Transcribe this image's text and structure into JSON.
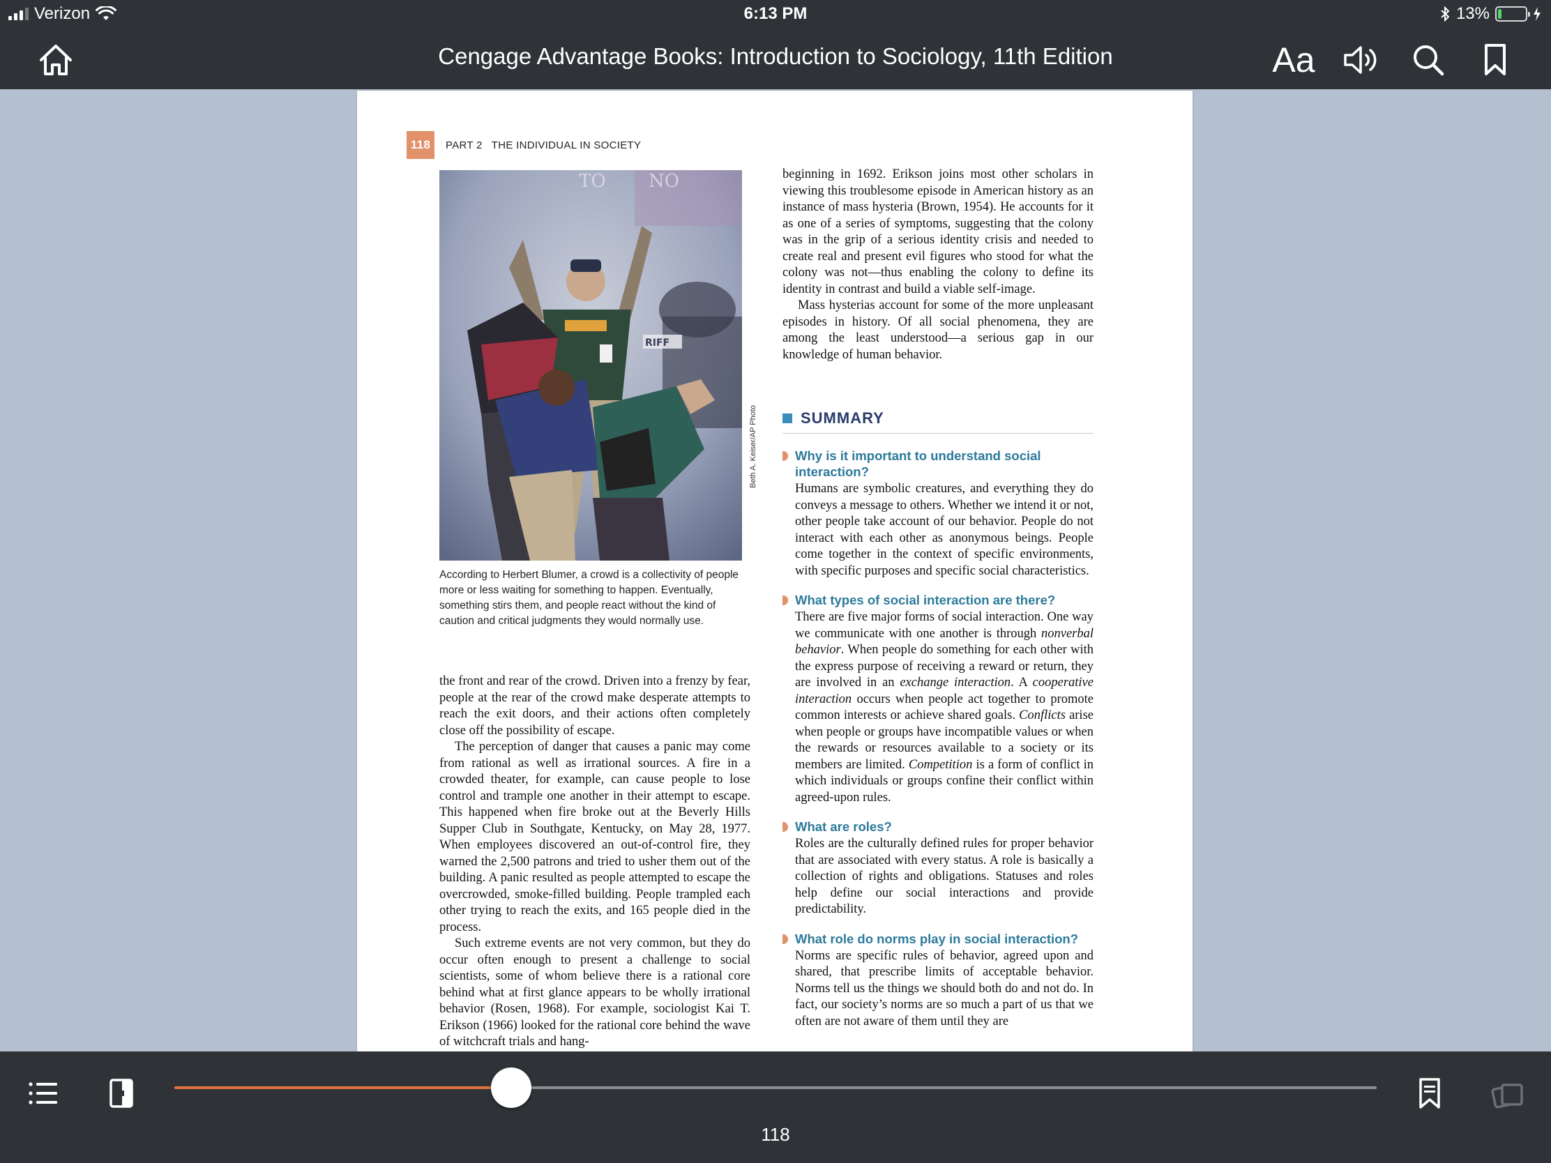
{
  "status_bar": {
    "carrier": "Verizon",
    "time": "6:13 PM",
    "battery_percent": "13%",
    "battery_level": 0.13
  },
  "toolbar": {
    "title": "Cengage Advantage Books: Introduction to Sociology, 11th Edition",
    "font_button": "Aa"
  },
  "page": {
    "number": "118",
    "running_head": "PART 2   THE INDIVIDUAL IN SOCIETY",
    "photo_credit": "Beth A. Keiser/AP Photo",
    "photo_sign_text_left": "TO",
    "photo_sign_text_right": "NO",
    "photo_badge_text": "RIFF",
    "caption": "According to Herbert Blumer, a crowd is a collectivity of people more or less waiting for something to happen. Eventually, something stirs them, and people react without the kind of caution and critical judgments they would normally use.",
    "left_column": [
      "the front and rear of the crowd. Driven into a frenzy by fear, people at the rear of the crowd make desperate attempts to reach the exit doors, and their actions often completely close off the possibility of escape.",
      "The perception of danger that causes a panic may come from rational as well as irrational sources. A fire in a crowded theater, for example, can cause people to lose control and trample one another in their attempt to escape. This happened when fire broke out at the Beverly Hills Supper Club in Southgate, Kentucky, on May 28, 1977. When employees discovered an out-of-control fire, they warned the 2,500 patrons and tried to usher them out of the building. A panic resulted as people attempted to escape the overcrowded, smoke-filled building. People trampled each other trying to reach the exits, and 165 people died in the process.",
      "Such extreme events are not very common, but they do occur often enough to present a challenge to social scientists, some of whom believe there is a rational core behind what at first glance appears to be wholly irrational behavior (Rosen, 1968). For example, sociologist Kai T. Erikson (1966) looked for the rational core behind the wave of witchcraft trials and hang-"
    ],
    "right_column": [
      "beginning in 1692. Erikson joins most other scholars in viewing this troublesome episode in American history as an instance of mass hysteria (Brown, 1954). He accounts for it as one of a series of symptoms, suggesting that the colony was in the grip of a serious identity crisis and needed to create real and present evil figures who stood for what the colony was not—thus enabling the colony to define its identity in contrast and build a viable self-image.",
      "Mass hysterias account for some of the more unpleasant episodes in history. Of all social phenomena, they are among the least understood—a serious gap in our knowledge of human behavior."
    ],
    "summary": {
      "heading": "SUMMARY",
      "items": [
        {
          "question": "Why is it important to understand social interaction?",
          "answer_html": "Humans are symbolic creatures, and everything they do conveys a message to others. Whether we intend it or not, other people take account of our behavior. People do not interact with each other as anonymous beings. People come together in the context of specific environments, with specific purposes and specific social characteristics."
        },
        {
          "question": "What types of social interaction are there?",
          "answer_html": "There are five major forms of social interaction. One way we communicate with one another is through <i>nonverbal behavior</i>. When people do something for each other with the express purpose of receiving a reward or return, they are involved in an <i>exchange interaction</i>. A <i>cooperative interaction</i> occurs when people act together to promote common interests or achieve shared goals. <i>Conflicts</i> arise when people or groups have incompatible values or when the rewards or resources available to a society or its members are limited. <i>Competition</i> is a form of conflict in which individuals or groups confine their conflict within agreed-upon rules."
        },
        {
          "question": "What are roles?",
          "answer_html": "Roles are the culturally defined rules for proper behavior that are associated with every status. A role is basically a collection of rights and obligations. Statuses and roles help define our social interactions and provide predictability."
        },
        {
          "question": "What role do norms play in social interaction?",
          "answer_html": "Norms are specific rules of behavior, agreed upon and shared, that prescribe limits of acceptable behavior. Norms tell us the things we should both do and not do. In fact, our society’s norms are so much a part of us that we often are not aware of them until they are"
        }
      ]
    }
  },
  "bottom_bar": {
    "page_label": "118",
    "progress_fraction": 0.28
  },
  "icons": {
    "home": "home-icon",
    "audio": "speaker-icon",
    "search": "search-icon",
    "bookmark": "bookmark-icon",
    "toc": "list-icon",
    "page_view": "page-view-icon",
    "bookmarks_list": "bookmarks-icon",
    "cards": "cards-icon"
  },
  "colors": {
    "toolbar_bg": "#2f3237",
    "page_number_badge": "#e1926b",
    "summary_question": "#2c7a9a",
    "summary_heading": "#2a3c6b",
    "slider_progress": "#e0733a"
  }
}
